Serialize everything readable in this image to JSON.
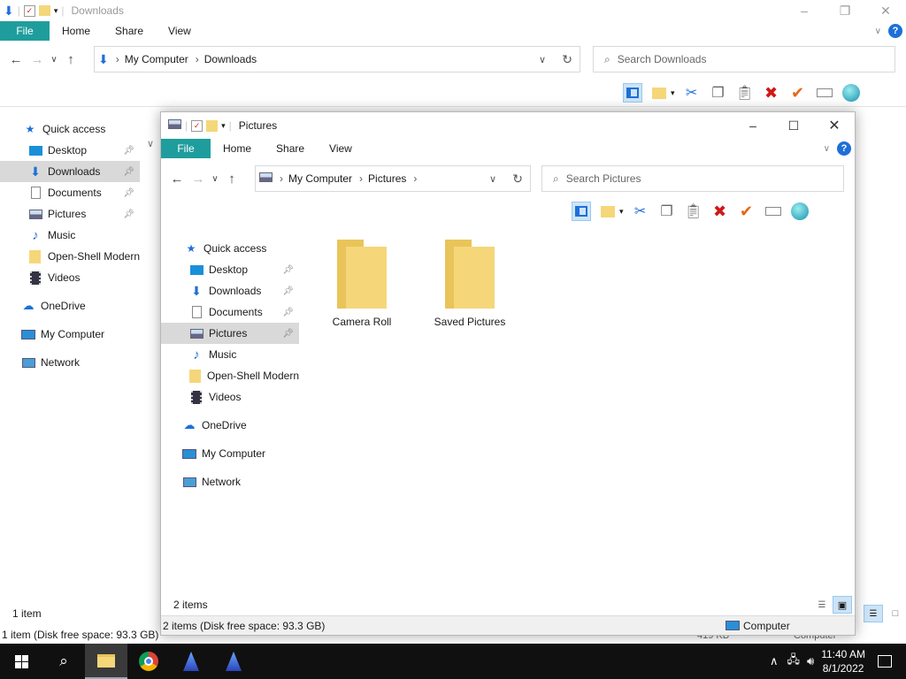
{
  "back_window": {
    "title": "Downloads",
    "tabs": {
      "file": "File",
      "home": "Home",
      "share": "Share",
      "view": "View"
    },
    "breadcrumb": [
      "My Computer",
      "Downloads"
    ],
    "search_placeholder": "Search Downloads",
    "nav": [
      {
        "label": "Quick access",
        "icon": "star-icon"
      },
      {
        "label": "Desktop",
        "icon": "desktop-icon",
        "pinned": true
      },
      {
        "label": "Downloads",
        "icon": "download-icon",
        "pinned": true,
        "selected": true
      },
      {
        "label": "Documents",
        "icon": "document-icon",
        "pinned": true
      },
      {
        "label": "Pictures",
        "icon": "pictures-icon",
        "pinned": true
      },
      {
        "label": "Music",
        "icon": "music-icon"
      },
      {
        "label": "Open-Shell Modern",
        "icon": "folder-icon"
      },
      {
        "label": "Videos",
        "icon": "video-icon"
      },
      {
        "label": "OneDrive",
        "icon": "cloud-icon"
      },
      {
        "label": "My Computer",
        "icon": "computer-icon"
      },
      {
        "label": "Network",
        "icon": "network-icon"
      }
    ],
    "item_count": "1 item",
    "status": "1 item (Disk free space: 93.3 GB)",
    "size_partial": "419 KB",
    "computer_partial": "Computer"
  },
  "front_window": {
    "title": "Pictures",
    "tabs": {
      "file": "File",
      "home": "Home",
      "share": "Share",
      "view": "View"
    },
    "breadcrumb": [
      "My Computer",
      "Pictures"
    ],
    "search_placeholder": "Search Pictures",
    "nav": [
      {
        "label": "Quick access",
        "icon": "star-icon"
      },
      {
        "label": "Desktop",
        "icon": "desktop-icon",
        "pinned": true
      },
      {
        "label": "Downloads",
        "icon": "download-icon",
        "pinned": true
      },
      {
        "label": "Documents",
        "icon": "document-icon",
        "pinned": true
      },
      {
        "label": "Pictures",
        "icon": "pictures-icon",
        "pinned": true,
        "selected": true
      },
      {
        "label": "Music",
        "icon": "music-icon"
      },
      {
        "label": "Open-Shell Modern",
        "icon": "folder-icon"
      },
      {
        "label": "Videos",
        "icon": "video-icon"
      },
      {
        "label": "OneDrive",
        "icon": "cloud-icon"
      },
      {
        "label": "My Computer",
        "icon": "computer-icon"
      },
      {
        "label": "Network",
        "icon": "network-icon"
      }
    ],
    "folders": [
      {
        "label": "Camera Roll"
      },
      {
        "label": "Saved Pictures"
      }
    ],
    "item_count": "2 items",
    "status": "2 items (Disk free space: 93.3 GB)",
    "status_right": "Computer"
  },
  "taskbar": {
    "time": "11:40 AM",
    "date": "8/1/2022"
  },
  "colors": {
    "file_tab": "#1f9d9d",
    "folder": "#f5d77a",
    "taskbar": "#101010"
  }
}
